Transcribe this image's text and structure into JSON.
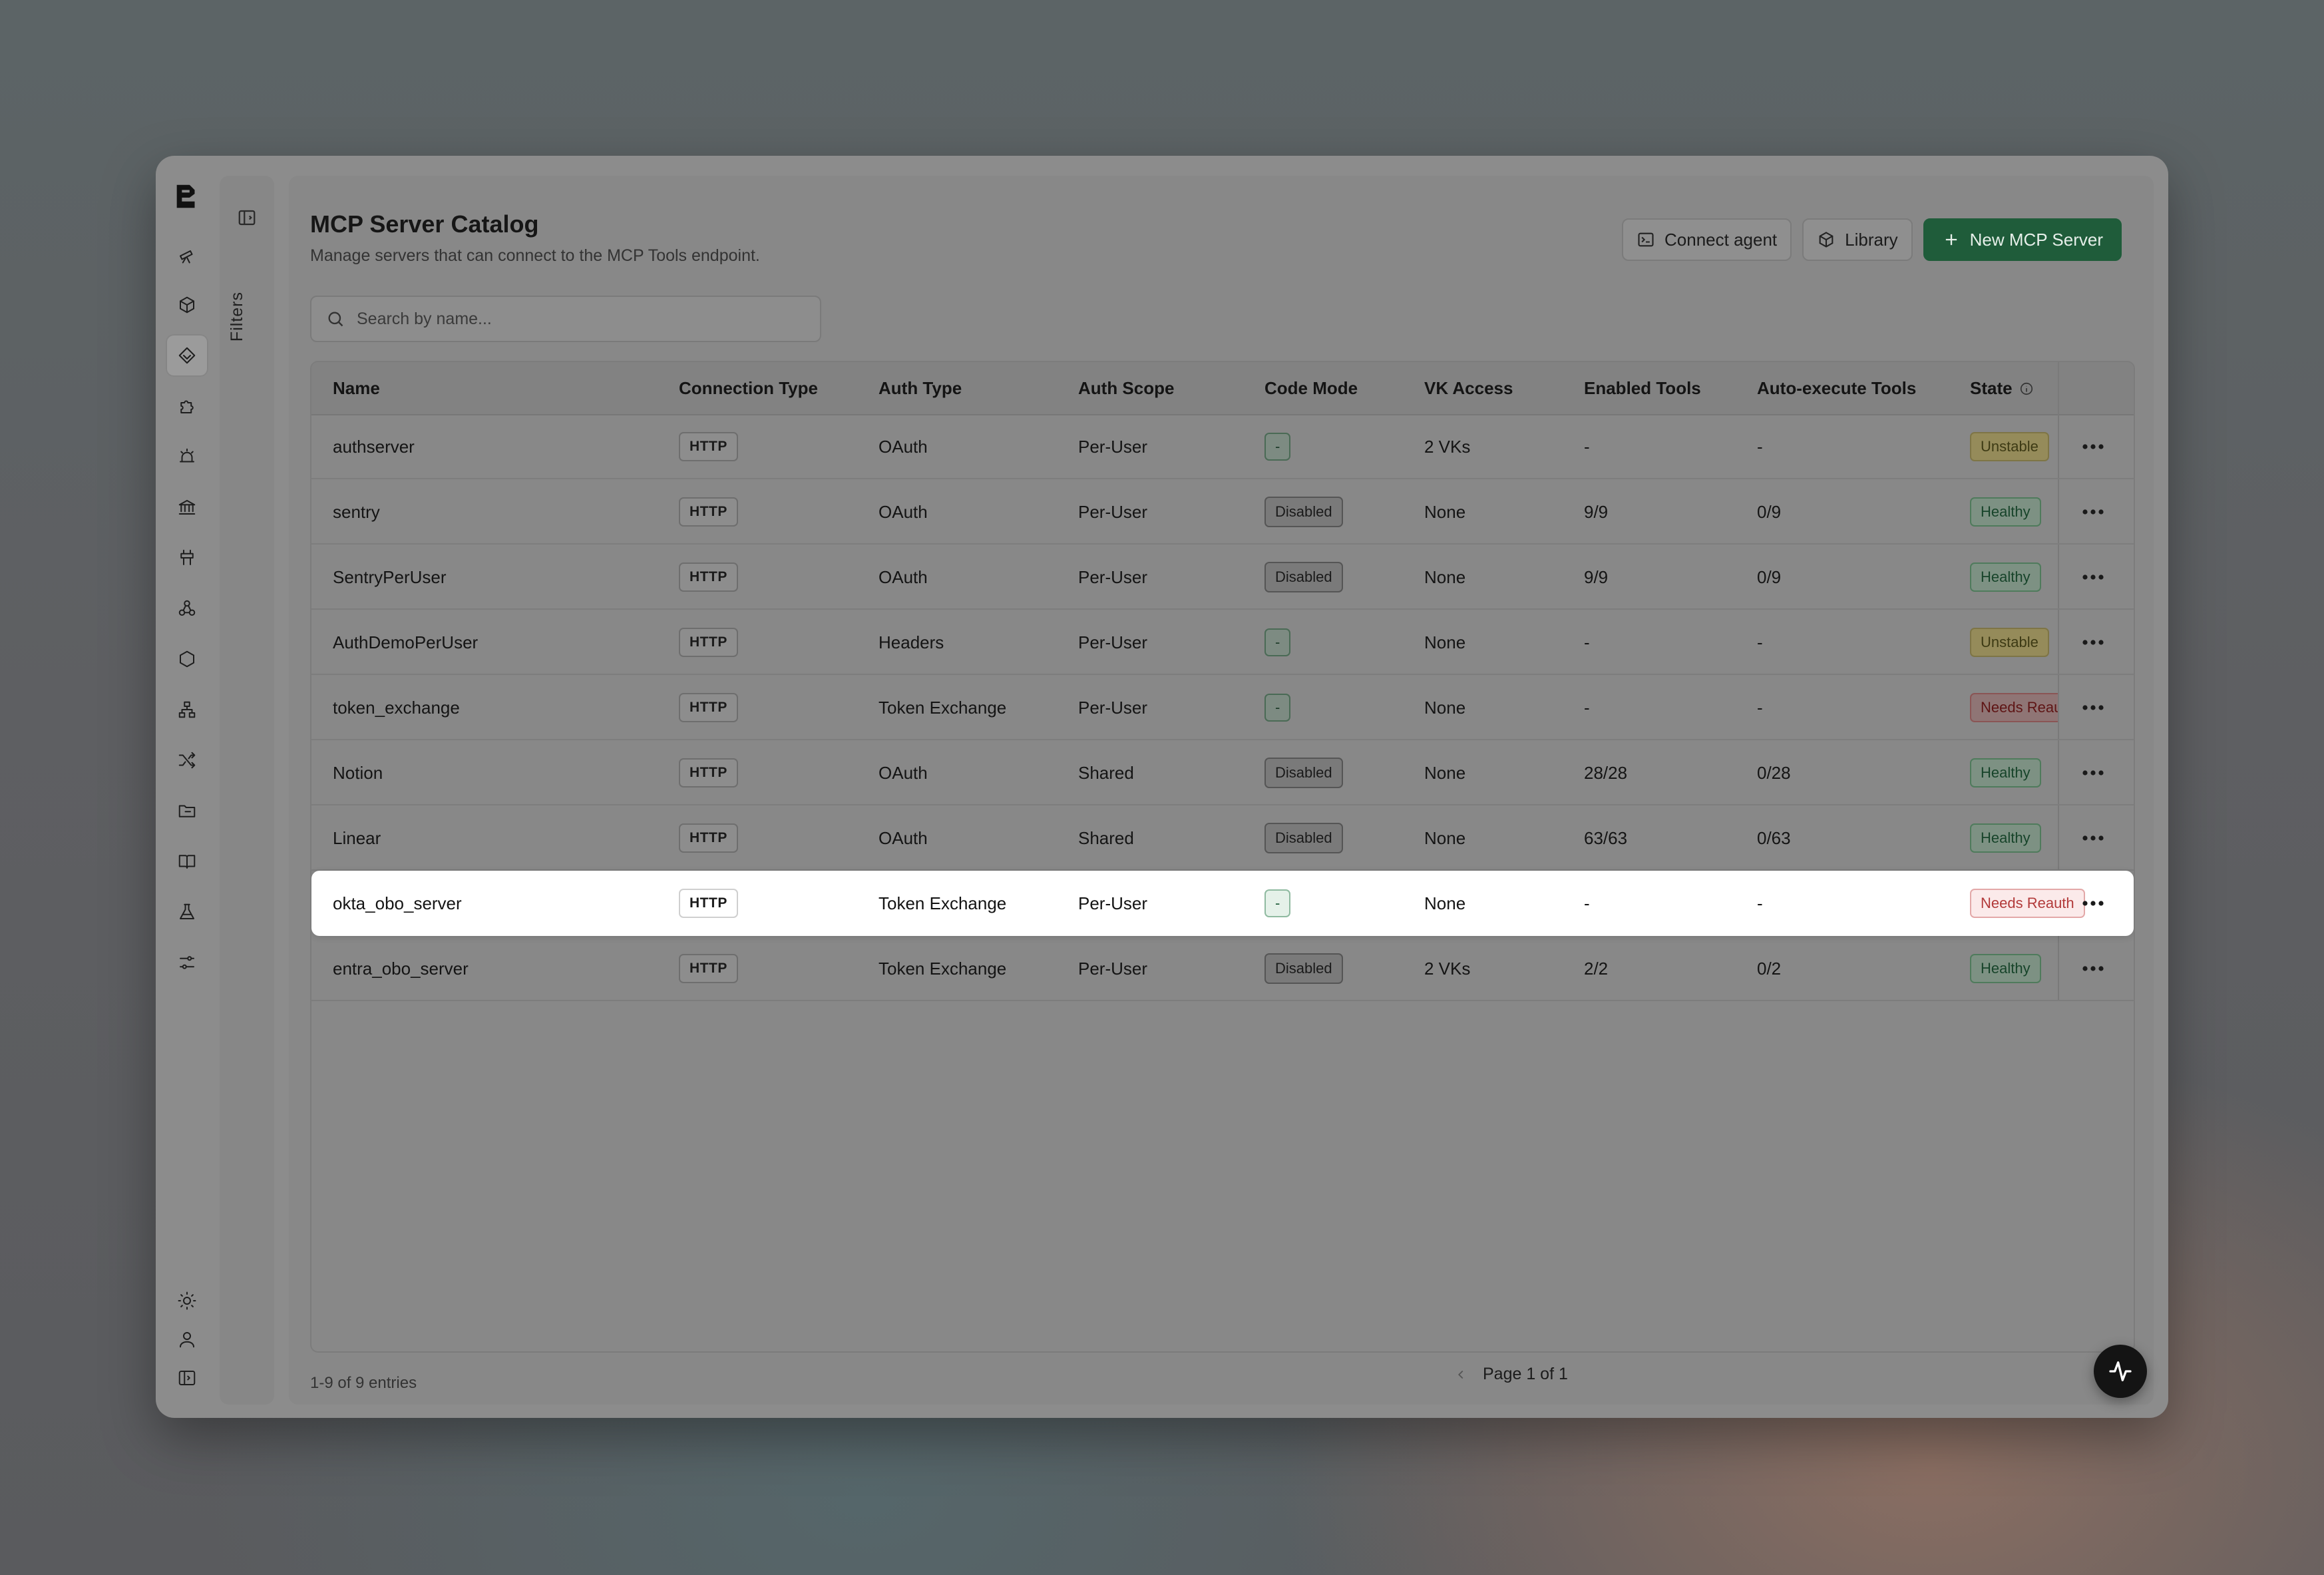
{
  "header": {
    "title": "MCP Server Catalog",
    "subtitle": "Manage servers that can connect to the MCP Tools endpoint."
  },
  "filters_label": "Filters",
  "actions": {
    "connect_agent": "Connect agent",
    "library": "Library",
    "new_server": "New MCP Server"
  },
  "search": {
    "placeholder": "Search by name..."
  },
  "table": {
    "columns": [
      "Name",
      "Connection Type",
      "Auth Type",
      "Auth Scope",
      "Code Mode",
      "VK Access",
      "Enabled Tools",
      "Auto-execute Tools",
      "State"
    ],
    "rows": [
      {
        "name": "authserver",
        "conn": "HTTP",
        "auth": "OAuth",
        "scope": "Per-User",
        "code": "-",
        "vk": "2 VKs",
        "enabled": "-",
        "auto": "-",
        "state": "Unstable"
      },
      {
        "name": "sentry",
        "conn": "HTTP",
        "auth": "OAuth",
        "scope": "Per-User",
        "code": "Disabled",
        "vk": "None",
        "enabled": "9/9",
        "auto": "0/9",
        "state": "Healthy"
      },
      {
        "name": "SentryPerUser",
        "conn": "HTTP",
        "auth": "OAuth",
        "scope": "Per-User",
        "code": "Disabled",
        "vk": "None",
        "enabled": "9/9",
        "auto": "0/9",
        "state": "Healthy"
      },
      {
        "name": "AuthDemoPerUser",
        "conn": "HTTP",
        "auth": "Headers",
        "scope": "Per-User",
        "code": "-",
        "vk": "None",
        "enabled": "-",
        "auto": "-",
        "state": "Unstable"
      },
      {
        "name": "token_exchange",
        "conn": "HTTP",
        "auth": "Token Exchange",
        "scope": "Per-User",
        "code": "-",
        "vk": "None",
        "enabled": "-",
        "auto": "-",
        "state": "Needs Reauth"
      },
      {
        "name": "Notion",
        "conn": "HTTP",
        "auth": "OAuth",
        "scope": "Shared",
        "code": "Disabled",
        "vk": "None",
        "enabled": "28/28",
        "auto": "0/28",
        "state": "Healthy"
      },
      {
        "name": "Linear",
        "conn": "HTTP",
        "auth": "OAuth",
        "scope": "Shared",
        "code": "Disabled",
        "vk": "None",
        "enabled": "63/63",
        "auto": "0/63",
        "state": "Healthy"
      },
      {
        "name": "okta_obo_server",
        "conn": "HTTP",
        "auth": "Token Exchange",
        "scope": "Per-User",
        "code": "-",
        "vk": "None",
        "enabled": "-",
        "auto": "-",
        "state": "Needs Reauth",
        "highlighted": true
      },
      {
        "name": "entra_obo_server",
        "conn": "HTTP",
        "auth": "Token Exchange",
        "scope": "Per-User",
        "code": "Disabled",
        "vk": "2 VKs",
        "enabled": "2/2",
        "auto": "0/2",
        "state": "Healthy"
      }
    ]
  },
  "footer": {
    "entries": "1-9 of 9 entries",
    "page": "Page 1 of 1"
  },
  "icons": {
    "rail": [
      "telescope-icon",
      "box-icon",
      "layers-icon",
      "puzzle-icon",
      "alarm-icon",
      "bank-icon",
      "road-sign-icon",
      "webhook-icon",
      "hexagon-icon",
      "network-icon",
      "shuffle-icon",
      "folder-icon",
      "book-icon",
      "flask-icon",
      "sliders-icon"
    ],
    "rail_bottom": [
      "sun-icon",
      "user-icon",
      "sidebar-icon"
    ]
  },
  "colors": {
    "primary": "#1f5c3a",
    "healthy": "#17442a",
    "unstable": "#3d3a14",
    "needs_reauth": "#b23a3a"
  }
}
